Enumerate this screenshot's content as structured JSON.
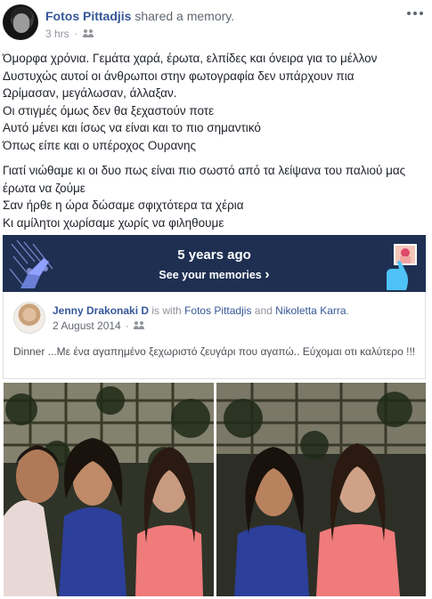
{
  "post": {
    "author": "Fotos Pittadjis",
    "action": "shared a memory.",
    "time": "3 hrs",
    "dot": "·",
    "audience_icon": "friends-icon",
    "more_icon": "more-dots-icon",
    "lines": [
      "Όμορφα χρόνια. Γεμάτα χαρά, έρωτα, ελπίδες και όνειρα για το μέλλον",
      "Δυστυχώς αυτοί οι άνθρωποι στην φωτογραφία δεν υπάρχουν πια",
      "Ωρίμασαν, μεγάλωσαν, άλλαξαν.",
      "Οι στιγμές όμως δεν θα ξεχαστούν ποτε",
      "Αυτό μένει και ίσως να είναι και το πιο σημαντικό",
      "Όπως είπε και ο υπέροχος Ουρανης"
    ],
    "lines2": [
      "Γιατί νιώθαμε κι οι δυο πως είναι πιο σωστό από τα λείψανα του παλιού μας",
      "έρωτα να ζούμε",
      "Σαν ήρθε η ώρα δώσαμε σφιχτότερα τα χέρια",
      "Κι αμίλητοι χωρίσαμε χωρίς να φιληθουμε"
    ]
  },
  "memory": {
    "title": "5 years ago",
    "link": "See your memories",
    "chevron": "›",
    "bg_color": "#1e2f52"
  },
  "shared": {
    "author": "Jenny Drakonaki D",
    "with_text": "is with",
    "tag1": "Fotos Pittadjis",
    "and_text": "and",
    "tag2": "Nikoletta Karra",
    "period": ".",
    "date": "2 August 2014",
    "dot": "·",
    "audience_icon": "friends-icon",
    "text": "Dinner ...Με ένα αγαπημένο ξεχωριστό ζευγάρι που αγαπώ.. Εύχομαι οτι καλύτερο !!!"
  },
  "colors": {
    "link": "#365899",
    "meta": "#90949c",
    "text": "#1d2129"
  }
}
